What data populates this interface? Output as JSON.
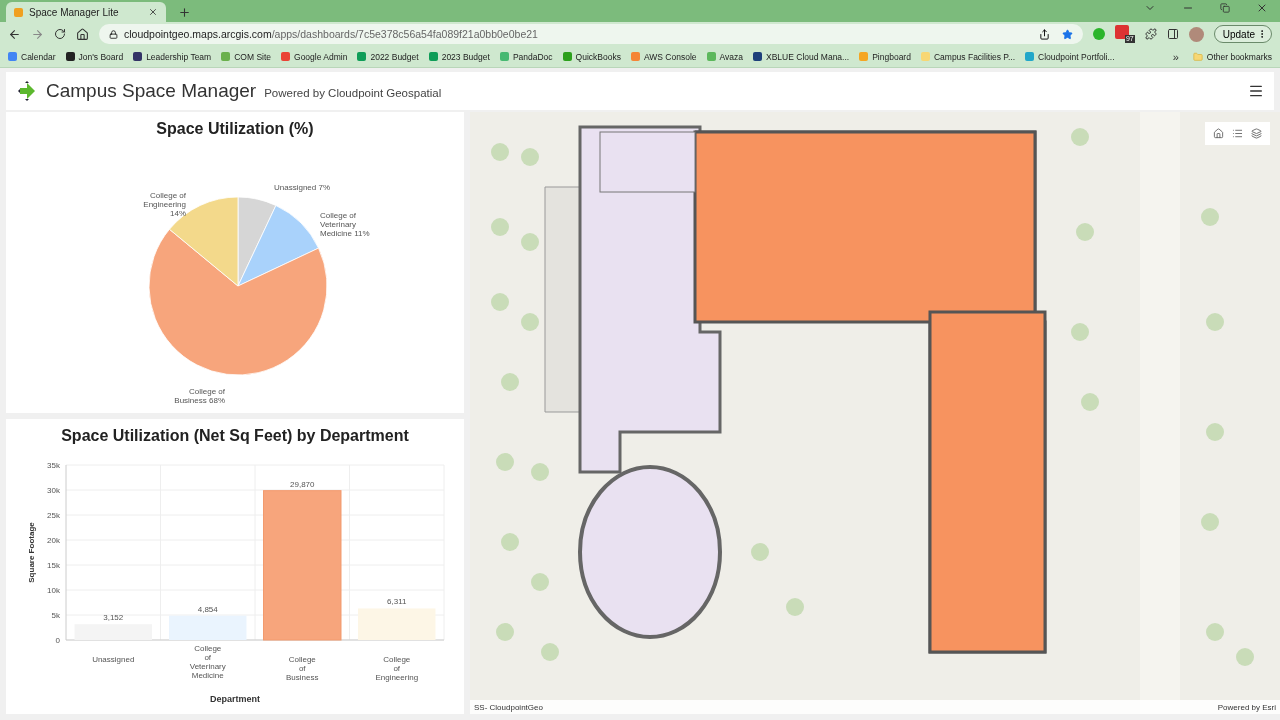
{
  "browser": {
    "tab": {
      "title": "Space Manager Lite",
      "selected": true
    },
    "address": {
      "host": "cloudpointgeo.maps.arcgis.com",
      "path": "/apps/dashboards/7c5e378c56a54fa089f21a0bb0e0be21"
    },
    "extension_badge": "97",
    "update_button": "Update",
    "bookmarks": [
      {
        "label": "Calendar",
        "color": "#4285f4"
      },
      {
        "label": "Jon's Board",
        "color": "#222222"
      },
      {
        "label": "Leadership Team",
        "color": "#333366"
      },
      {
        "label": "COM Site",
        "color": "#6ab04c"
      },
      {
        "label": "Google Admin",
        "color": "#ea4335"
      },
      {
        "label": "2022 Budget",
        "color": "#0f9d58"
      },
      {
        "label": "2023 Budget",
        "color": "#0f9d58"
      },
      {
        "label": "PandaDoc",
        "color": "#47b972"
      },
      {
        "label": "QuickBooks",
        "color": "#2ca01c"
      },
      {
        "label": "AWS Console",
        "color": "#f58536"
      },
      {
        "label": "Avaza",
        "color": "#5cb85c"
      },
      {
        "label": "XBLUE Cloud Mana...",
        "color": "#1d3f7a"
      },
      {
        "label": "Pingboard",
        "color": "#f5a623"
      },
      {
        "label": "Campus Facilities P...",
        "color": "#f7d774"
      },
      {
        "label": "Cloudpoint Portfoli...",
        "color": "#22a7c9"
      }
    ],
    "overflow": "»",
    "other_bookmarks": "Other bookmarks"
  },
  "header": {
    "title": "Campus Space Manager",
    "subtitle": "Powered by Cloudpoint Geospatial"
  },
  "pie_panel": {
    "title": "Space Utilization (%)",
    "chart_data": {
      "type": "pie",
      "values": [
        7,
        11,
        68,
        14
      ],
      "colors": [
        "#d6d6d6",
        "#a9d2fb",
        "#f7a57c",
        "#f3d98b"
      ],
      "value_labels": [
        "Unassigned 7%",
        "College of\nVeterinary\nMedicine 11%",
        "College of\nBusiness 68%",
        "College of\nEngineering\n14%"
      ]
    }
  },
  "bar_panel": {
    "title": "Space Utilization (Net Sq Feet) by Department",
    "chart_data": {
      "type": "bar",
      "xlabel": "Department",
      "ylabel": "Square Footage",
      "categories": [
        "Unassigned",
        "College\nof\nVeterinary\nMedicine",
        "College\nof\nBusiness",
        "College\nof\nEngineering"
      ],
      "series": [
        {
          "values": [
            3152,
            4854,
            29870,
            6311
          ]
        }
      ],
      "grid": true,
      "ylim": [
        0,
        35000
      ],
      "yticks": [
        {
          "value": 0,
          "label": "0"
        },
        {
          "value": 5000,
          "label": "5k"
        },
        {
          "value": 10000,
          "label": "10k"
        },
        {
          "value": 15000,
          "label": "15k"
        },
        {
          "value": 20000,
          "label": "20k"
        },
        {
          "value": 25000,
          "label": "25k"
        },
        {
          "value": 30000,
          "label": "30k"
        },
        {
          "value": 35000,
          "label": "35k"
        }
      ],
      "value_labels": [
        "3,152",
        "4,854",
        "29,870",
        "6,311"
      ]
    },
    "bars": [
      {
        "selected": false,
        "color": "#f4f4f4"
      },
      {
        "selected": false,
        "color": "#eaf4fe"
      },
      {
        "selected": true,
        "color": "#f7a57c"
      },
      {
        "selected": false,
        "color": "#fdf6e6"
      }
    ]
  },
  "map": {
    "kind": "picture",
    "attribution_left": "SS- CloudpointGeo",
    "attribution_right": "Powered by Esri"
  }
}
